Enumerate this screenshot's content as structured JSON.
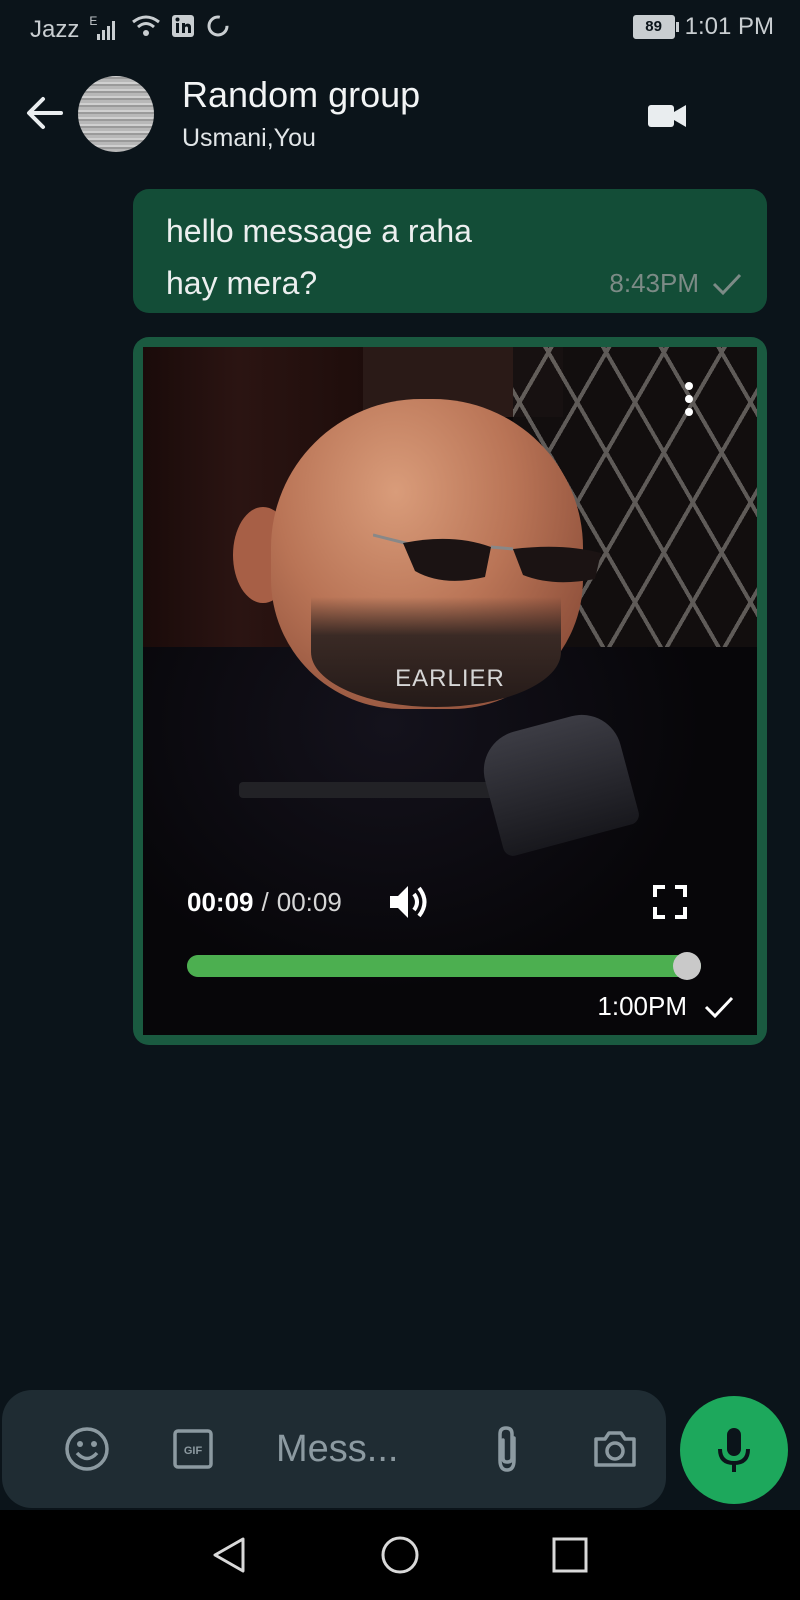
{
  "status_bar": {
    "carrier": "Jazz",
    "network_type": "E",
    "battery_level": "89",
    "time": "1:01 PM",
    "icons": [
      "signal-icon",
      "wifi-icon",
      "linkedin-icon",
      "sync-icon",
      "battery-icon"
    ]
  },
  "header": {
    "title": "Random group",
    "subtitle": "Usmani,You",
    "back_icon": "arrow-left-icon",
    "video_call_icon": "video-camera-icon"
  },
  "messages": [
    {
      "type": "text",
      "text_line1": "hello message a raha",
      "text_line2": "hay mera?",
      "time": "8:43PM",
      "status_icon": "single-check-icon"
    },
    {
      "type": "video",
      "overlay_caption": "EARLIER",
      "current_time": "00:09",
      "separator": "/",
      "duration": "00:09",
      "progress": 1.0,
      "time": "1:00PM",
      "status_icon": "single-check-icon"
    }
  ],
  "input_bar": {
    "placeholder": "Mess...",
    "icons": [
      "emoji-icon",
      "gif-icon",
      "attach-icon",
      "camera-icon"
    ],
    "send_icon": "microphone-icon"
  },
  "colors": {
    "background": "#0b141a",
    "outgoing_bubble": "#134d37",
    "progress": "#4caf50",
    "mic_button": "#1da85c"
  }
}
